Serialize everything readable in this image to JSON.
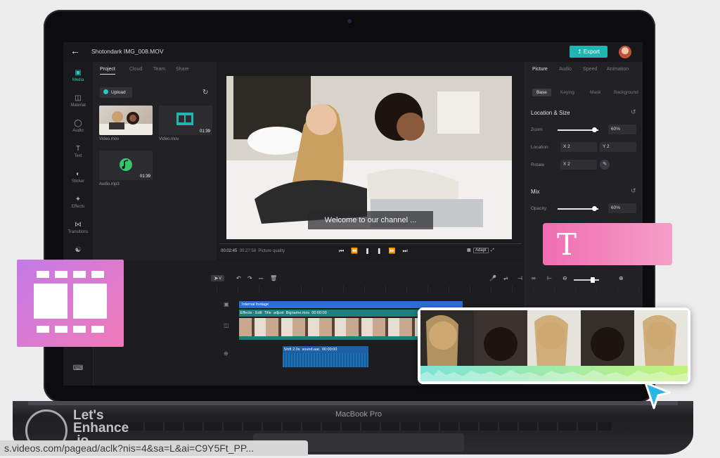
{
  "app": {
    "project_title": "Shotondark IMG_008.MOV",
    "export_label": "Export",
    "accent_color": "#1fb5b0"
  },
  "left_rail": {
    "items": [
      {
        "label": "Media",
        "icon": "media-icon",
        "active": true
      },
      {
        "label": "Material",
        "icon": "material-icon"
      },
      {
        "label": "Audio",
        "icon": "audio-icon"
      },
      {
        "label": "Text",
        "icon": "text-icon"
      },
      {
        "label": "Sticker",
        "icon": "sticker-icon"
      },
      {
        "label": "Effects",
        "icon": "effects-icon"
      },
      {
        "label": "Transitions",
        "icon": "transitions-icon"
      }
    ]
  },
  "media_panel": {
    "tabs": [
      "Project",
      "Cloud",
      "Team",
      "Share"
    ],
    "upload_label": "Upload",
    "files": [
      {
        "name": "Video.mov",
        "duration": ""
      },
      {
        "name": "Video.mov",
        "duration": "01:39"
      },
      {
        "name": "Audio.mp3",
        "duration": "01:39"
      }
    ]
  },
  "preview": {
    "caption": "Welcome to our channel ...",
    "current_time": "00:02:45",
    "total_time": "00:27:58",
    "quality_label": "Picture quality",
    "adapt_label": "Adapt"
  },
  "properties": {
    "tabs": [
      "Picture",
      "Audio",
      "Speed",
      "Animation"
    ],
    "subtabs": [
      "Base",
      "Keying",
      "Mask",
      "Background"
    ],
    "section_location": "Location & Size",
    "zoom_label": "Zoom",
    "zoom_value": "60%",
    "zoom_level": 0.9,
    "location_label": "Location",
    "location_x": "X 2",
    "location_y": "Y 2",
    "rotate_label": "Rotate",
    "rotate_value": "X 2",
    "section_mix": "Mix",
    "opacity_label": "Opacity",
    "opacity_value": "60%",
    "opacity_level": 0.9
  },
  "timeline": {
    "tracks": [
      {
        "label": "Internal footage",
        "color": "#2d6fd0"
      },
      {
        "label": "Effects · Edit",
        "color": "#1f8a86"
      },
      {
        "label": "Title",
        "color": "#1f8a86"
      },
      {
        "label": "adjust",
        "color": "#1f8a86"
      },
      {
        "label": "Bigname.mov",
        "color": "#1f8a86"
      },
      {
        "label": "00:00:00",
        "color": "#1f8a86"
      },
      {
        "label": "Shift 2.0s",
        "color": "#1f5fa8"
      },
      {
        "label": "sound.aac",
        "color": "#1f5fa8"
      },
      {
        "label": "00:00:00",
        "color": "#1f5fa8"
      }
    ]
  },
  "overlays": {
    "text_card_glyph": "T",
    "laptop_brand": "MacBook Pro"
  },
  "watermark": {
    "line1": "Let's",
    "line2": "Enhance",
    "line3": ".io"
  },
  "status_url": "s.videos.com/pagead/aclk?nis=4&sa=L&ai=C9Y5Ft_PP..."
}
